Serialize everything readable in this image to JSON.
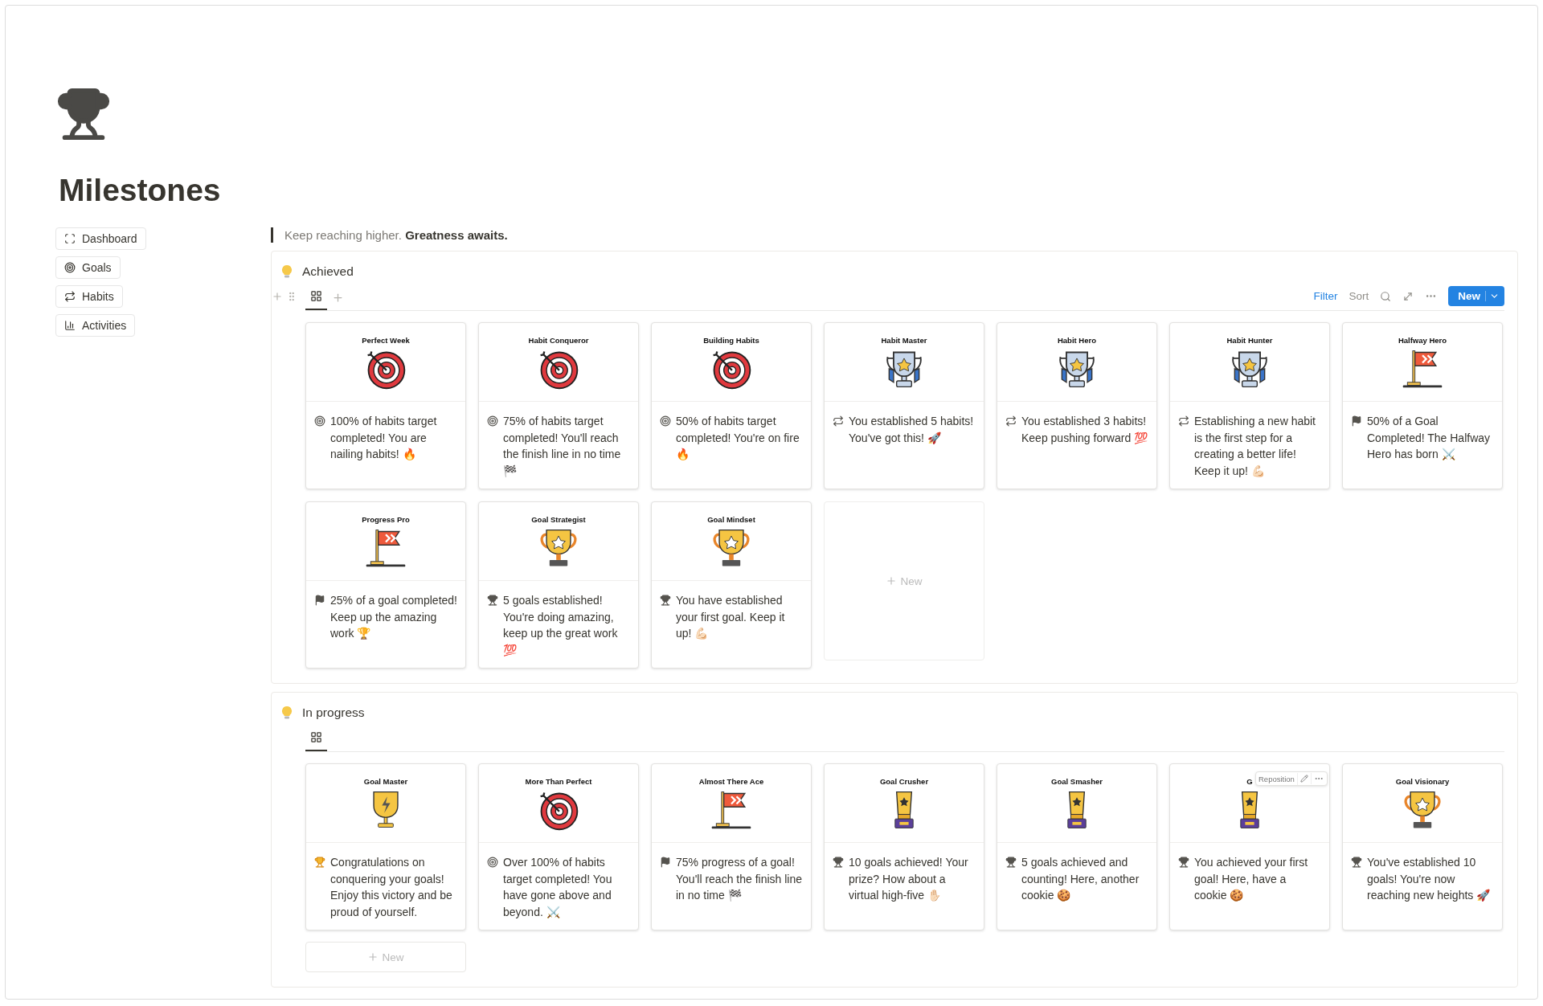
{
  "page": {
    "title": "Milestones"
  },
  "links": [
    {
      "label": "Dashboard",
      "kind": "dashboard"
    },
    {
      "label": "Goals",
      "kind": "goals"
    },
    {
      "label": "Habits",
      "kind": "habits"
    },
    {
      "label": "Activities",
      "kind": "activities"
    }
  ],
  "quote": {
    "text": "Keep reaching higher. **Greatness awaits.**"
  },
  "sections": [
    {
      "title": "Achieved",
      "views": [
        {
          "kind": "gallery",
          "selected": true
        }
      ],
      "add_view": true,
      "toolbar": {
        "filter": "Filter",
        "sort": "Sort",
        "new": "New"
      },
      "new_card": {
        "label": "New",
        "kind": "tile"
      },
      "cards": [
        {
          "cover_title": "Perfect Week",
          "kind": "target",
          "text": "100% of habits target completed! You are nailing habits! 🔥"
        },
        {
          "cover_title": "Habit Conqueror",
          "kind": "target",
          "text": "75% of habits target completed! You'll reach the finish line in no time 🏁"
        },
        {
          "cover_title": "Building Habits",
          "kind": "target",
          "text": "50% of habits target completed! You're on fire 🔥"
        },
        {
          "cover_title": "Habit Master",
          "kind": "habit",
          "text": "You established 5 habits! You've got this! 🚀"
        },
        {
          "cover_title": "Habit Hero",
          "kind": "habit",
          "text": "You established 3 habits! Keep pushing forward 💯"
        },
        {
          "cover_title": "Habit Hunter",
          "kind": "habit",
          "text": "Establishing a new habit is the first step for a creating a better life! Keep it up! 💪🏻"
        },
        {
          "cover_title": "Halfway Hero",
          "kind": "flag",
          "text": "50% of a Goal Completed! The Halfway Hero has born ⚔️"
        },
        {
          "cover_title": "Progress Pro",
          "kind": "flag",
          "text": "25% of a goal completed! Keep up the amazing work 🏆"
        },
        {
          "cover_title": "Goal Strategist",
          "kind": "goal",
          "text": "5 goals established! You're doing amazing, keep up the great work 💯"
        },
        {
          "cover_title": "Goal Mindset",
          "kind": "goal",
          "text": "You have established your first goal. Keep it up! 💪🏻"
        }
      ]
    },
    {
      "title": "In progress",
      "views": [
        {
          "kind": "gallery",
          "selected": true
        }
      ],
      "add_view": false,
      "new_card": {
        "label": "New",
        "kind": "bar"
      },
      "cards": [
        {
          "cover_title": "Goal Master",
          "kind": "master",
          "text": "Congratulations on conquering your goals! Enjoy this victory and be proud of yourself."
        },
        {
          "cover_title": "More Than Perfect",
          "kind": "target",
          "text": "Over 100% of habits target completed! You have gone above and beyond. ⚔️"
        },
        {
          "cover_title": "Almost There Ace",
          "kind": "flag",
          "text": "75% progress of a goal! You'll reach the finish line in no time 🏁"
        },
        {
          "cover_title": "Goal Crusher",
          "kind": "award",
          "text": "10 goals achieved! Your prize? How about a virtual high-five ✋🏻"
        },
        {
          "cover_title": "Goal Smasher",
          "kind": "award",
          "text": "5 goals achieved and counting! Here, another cookie 🍪"
        },
        {
          "cover_title": "G",
          "kind": "award",
          "text": "You achieved your first goal! Here, have a cookie 🍪",
          "hover_toolbar": "Reposition"
        },
        {
          "cover_title": "Goal Visionary",
          "kind": "goal",
          "text": "You've established 10 goals! You're now reaching new heights 🚀"
        }
      ]
    }
  ]
}
